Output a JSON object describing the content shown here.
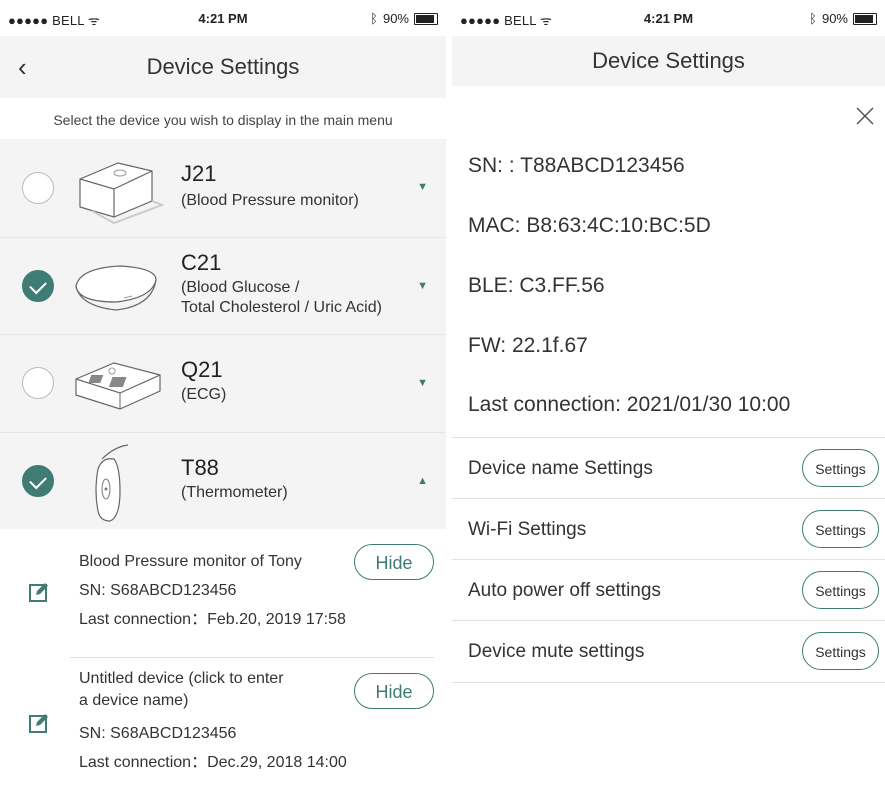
{
  "status_bar": {
    "carrier": "●●●●● BELL ᯤ",
    "time": "4:21 PM",
    "battery": "90%",
    "bluetooth": "ᛒ"
  },
  "left": {
    "nav": {
      "back": "‹",
      "title": "Device Settings"
    },
    "hint": "Select the device you wish to display in the main menu",
    "devices": [
      {
        "name": "J21",
        "desc1": "(Blood Pressure monitor)",
        "desc2": "",
        "checked": false,
        "arrow": "▼"
      },
      {
        "name": "C21",
        "desc1": "(Blood Glucose /",
        "desc2": "Total Cholesterol / Uric Acid)",
        "checked": true,
        "arrow": "▼"
      },
      {
        "name": "Q21",
        "desc1": "(ECG)",
        "desc2": "",
        "checked": false,
        "arrow": "▼"
      },
      {
        "name": "T88",
        "desc1": "(Thermometer)",
        "desc2": "",
        "checked": true,
        "arrow": "▲"
      }
    ],
    "sub_devices": [
      {
        "line1": "Blood Pressure monitor of Tony",
        "sn": "SN: S68ABCD123456",
        "last": "Last connection：Feb.20, 2019 17:58",
        "hide": "Hide"
      },
      {
        "line1": "Untitled device (click to enter",
        "line2": "a device name)",
        "sn": "SN: S68ABCD123456",
        "last": "Last connection：Dec.29, 2018 14:00",
        "hide": "Hide"
      }
    ]
  },
  "right": {
    "nav": {
      "title": "Device Settings"
    },
    "close": "×",
    "info": {
      "sn": "SN: : T88ABCD123456",
      "mac": "MAC: B8:63:4C:10:BC:5D",
      "ble": "BLE: C3.FF.56",
      "fw": "FW: 22.1f.67",
      "last": "Last connection: 2021/01/30 10:00"
    },
    "settings": [
      {
        "label": "Device name Settings",
        "button": "Settings"
      },
      {
        "label": "Wi-Fi Settings",
        "button": "Settings"
      },
      {
        "label": "Auto power off settings",
        "button": "Settings"
      },
      {
        "label": "Device mute settings",
        "button": "Settings"
      }
    ]
  },
  "colors": {
    "accent": "#3f7c73",
    "row_bg": "#f4f4f4"
  }
}
